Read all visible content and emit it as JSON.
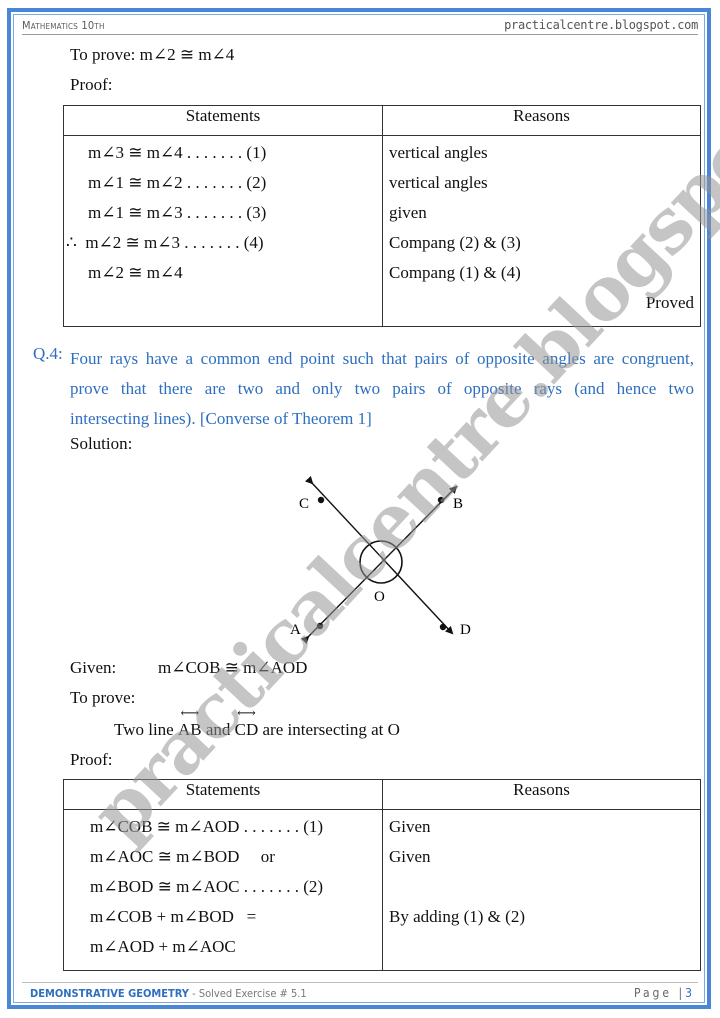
{
  "header": {
    "subject": "Mathematics 10th",
    "site": "practicalcentre.blogspot.com"
  },
  "part1": {
    "to_prove": "To prove: m∠2 ≅ m∠4",
    "proof_label": "Proof:",
    "table": {
      "headers": [
        "Statements",
        "Reasons"
      ],
      "statements": [
        "m∠3 ≅ m∠4 . . . . . . . (1)",
        "m∠1 ≅ m∠2 . . . . . . . (2)",
        "m∠1 ≅ m∠3 . . . . . . . (3)",
        "m∠2 ≅ m∠3 . . . . . . . (4)",
        "m∠2 ≅ m∠4"
      ],
      "therefore_symbol": "∴",
      "reasons": [
        "vertical angles",
        "vertical angles",
        "given",
        "Compang (2) & (3)",
        "Compang (1) & (4)"
      ],
      "conclusion": "Proved"
    }
  },
  "question": {
    "label": "Q.4:",
    "text_lines": [
      "Four rays have a common end point such that pairs of opposite angles are congruent,",
      "prove that there are two and only two pairs of opposite rays (and hence two",
      "intersecting lines). [Converse of Theorem 1]"
    ],
    "solution_label": "Solution:"
  },
  "diagram": {
    "points": {
      "A": "A",
      "B": "B",
      "C": "C",
      "D": "D",
      "O": "O"
    }
  },
  "part2": {
    "given_label": "Given:",
    "given_value": "m∠COB ≅ m∠AOD",
    "to_prove_label": "To prove:",
    "to_prove_pre": "Two line ",
    "line1": "AB",
    "to_prove_mid": " and ",
    "line2": "CD",
    "to_prove_post": " are intersecting at O",
    "proof_label": "Proof:",
    "table": {
      "headers": [
        "Statements",
        "Reasons"
      ],
      "statements": [
        "m∠COB ≅ m∠AOD . . . . . . . (1)",
        "m∠AOC ≅ m∠BOD     or",
        "m∠BOD ≅ m∠AOC . . . . . . . (2)",
        "m∠COB + m∠BOD   =",
        "m∠AOD + m∠AOC"
      ],
      "reasons": [
        "Given",
        "Given",
        "",
        "By adding (1) & (2)",
        ""
      ]
    }
  },
  "footer": {
    "topic": "DEMONSTRATIVE GEOMETRY",
    "exercise": " - Solved Exercise # 5.1",
    "page_label": "Page |",
    "page_number": "3"
  },
  "watermark": "practicalcentre.blogspot.com",
  "colors": {
    "frame_blue": "#4a86d6",
    "question_blue": "#2e6fbf"
  }
}
